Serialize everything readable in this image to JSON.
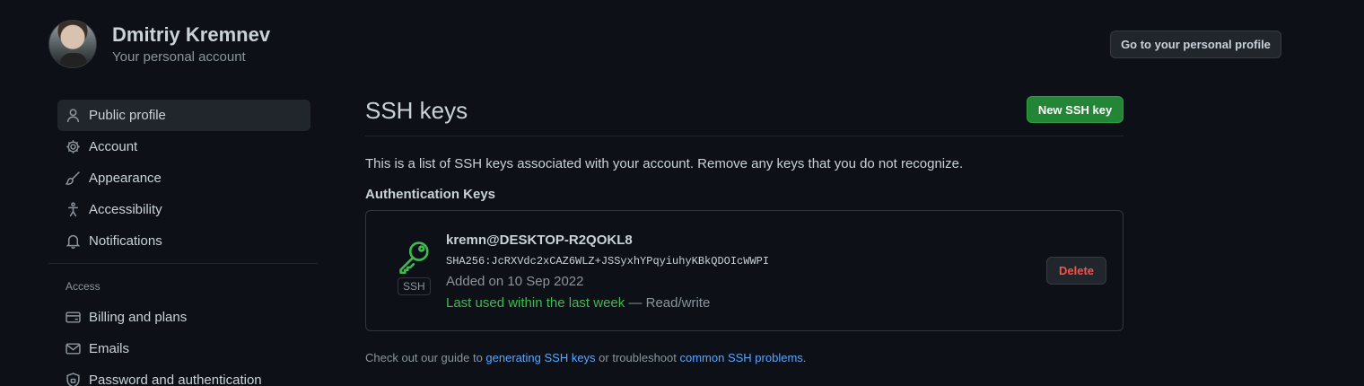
{
  "user": {
    "name": "Dmitriy Kremnev",
    "subtitle": "Your personal account"
  },
  "header": {
    "profile_button": "Go to your personal profile"
  },
  "sidebar": {
    "items": [
      {
        "label": "Public profile",
        "icon": "person-icon",
        "active": true
      },
      {
        "label": "Account",
        "icon": "gear-icon"
      },
      {
        "label": "Appearance",
        "icon": "paintbrush-icon"
      },
      {
        "label": "Accessibility",
        "icon": "accessibility-icon"
      },
      {
        "label": "Notifications",
        "icon": "bell-icon"
      }
    ],
    "access_heading": "Access",
    "access_items": [
      {
        "label": "Billing and plans",
        "icon": "credit-card-icon"
      },
      {
        "label": "Emails",
        "icon": "mail-icon"
      },
      {
        "label": "Password and authentication",
        "icon": "shield-lock-icon"
      }
    ]
  },
  "main": {
    "title": "SSH keys",
    "new_key_button": "New SSH key",
    "intro": "This is a list of SSH keys associated with your account. Remove any keys that you do not recognize.",
    "section_title": "Authentication Keys",
    "key": {
      "type_label": "SSH",
      "name": "kremn@DESKTOP-R2QOKL8",
      "fingerprint": "SHA256:JcRXVdc2xCAZ6WLZ+JSSyxhYPqyiuhyKBkQDOIcWWPI",
      "added": "Added on 10 Sep 2022",
      "last_used": "Last used within the last week",
      "access": " — Read/write",
      "delete_button": "Delete"
    },
    "footer": {
      "prefix": "Check out our guide to ",
      "link1": "generating SSH keys",
      "middle": " or troubleshoot ",
      "link2": "common SSH problems",
      "suffix": "."
    }
  },
  "colors": {
    "background": "#0d1117",
    "primary_button": "#238636",
    "danger_text": "#f85149",
    "link": "#58a6ff",
    "key_icon": "#3fb950"
  }
}
